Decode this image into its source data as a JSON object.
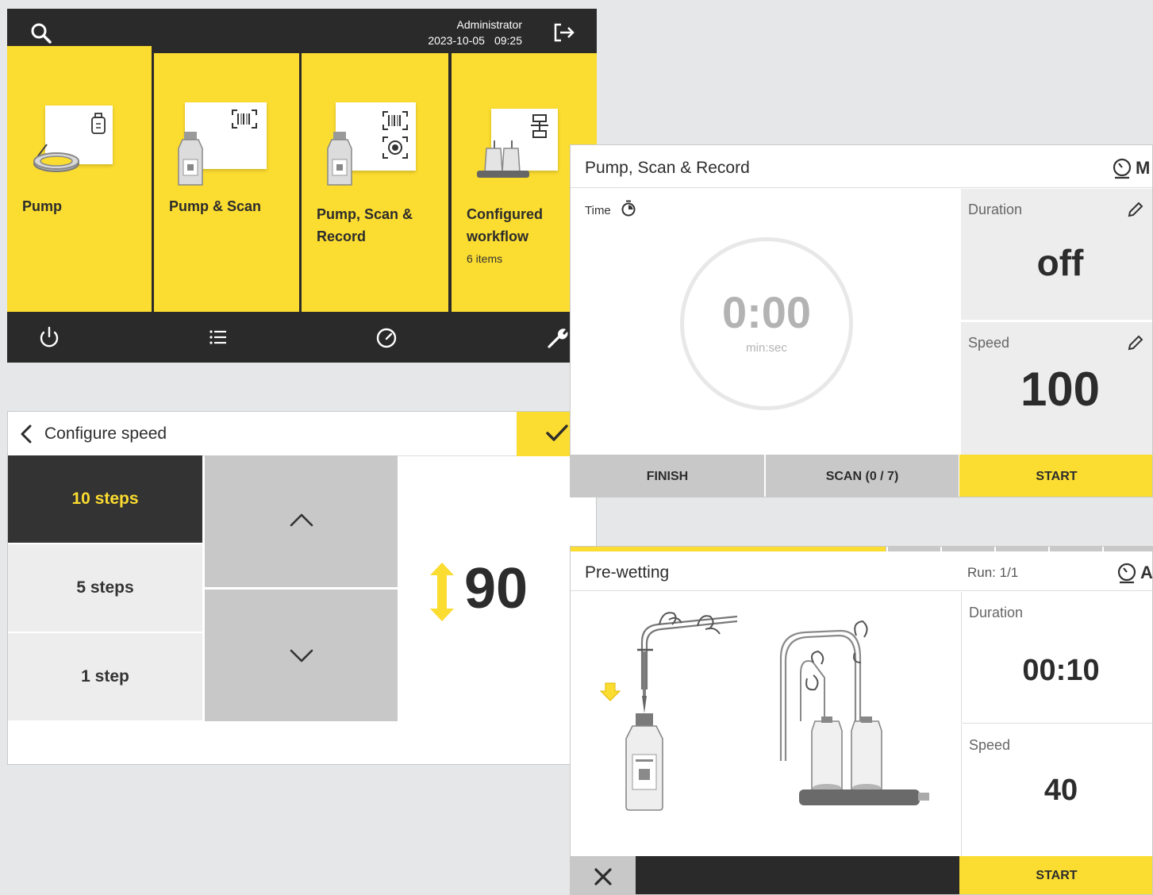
{
  "home": {
    "user_name": "Administrator",
    "date": "2023-10-05",
    "time": "09:25",
    "tiles": [
      {
        "label_lines": [
          "Pump"
        ],
        "subtitle": ""
      },
      {
        "label_lines": [
          "Pump & Scan"
        ],
        "subtitle": ""
      },
      {
        "label_lines": [
          "Pump, Scan &",
          "Record"
        ],
        "subtitle": ""
      },
      {
        "label_lines": [
          "Configured",
          "workflow"
        ],
        "subtitle": "6 items"
      }
    ],
    "icons": {
      "search": "search-icon",
      "logout": "logout-icon",
      "power": "power-icon",
      "list": "list-icon",
      "gauge": "gauge-icon",
      "wrench": "wrench-icon"
    }
  },
  "pump_scan_record": {
    "title": "Pump, Scan & Record",
    "mode_letter": "M",
    "time_label": "Time",
    "timer_value": "0:00",
    "timer_unit": "min:sec",
    "duration_label": "Duration",
    "duration_value": "off",
    "speed_label": "Speed",
    "speed_value": "100",
    "buttons": {
      "finish": "FINISH",
      "scan": "SCAN (0 / 7)",
      "start": "START"
    }
  },
  "configure_speed": {
    "title": "Configure speed",
    "steps": [
      "10 steps",
      "5 steps",
      "1 step"
    ],
    "selected_step_index": 0,
    "value": "90"
  },
  "pre_wetting": {
    "title": "Pre-wetting",
    "run": "Run: 1/1",
    "mode_letter": "A",
    "progress_fraction": 0.54,
    "duration_label": "Duration",
    "duration_value": "00:10",
    "speed_label": "Speed",
    "speed_value": "40",
    "start_label": "START"
  },
  "colors": {
    "accent_yellow": "#fbdc30",
    "dark": "#2a2a2a",
    "panel_gray": "#ededed",
    "button_gray": "#c8c8c8"
  }
}
